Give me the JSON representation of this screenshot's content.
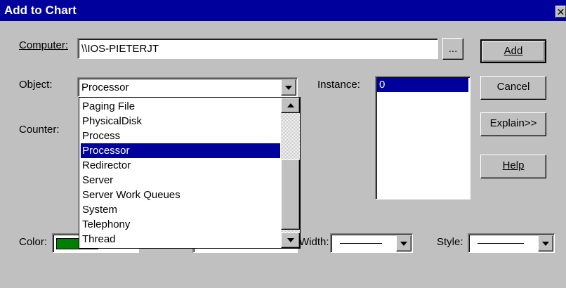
{
  "window": {
    "title": "Add to Chart",
    "close_label": "✕"
  },
  "computer": {
    "label": "Computer:",
    "value": "\\\\IOS-PIETERJT",
    "browse_label": "..."
  },
  "object": {
    "label": "Object:",
    "value": "Processor"
  },
  "instance": {
    "label": "Instance:",
    "items": [
      "0"
    ]
  },
  "counter": {
    "label": "Counter:"
  },
  "object_dropdown": {
    "items": [
      "Paging File",
      "PhysicalDisk",
      "Process",
      "Processor",
      "Redirector",
      "Server",
      "Server Work Queues",
      "System",
      "Telephony",
      "Thread"
    ],
    "selected_index": 3
  },
  "buttons": {
    "add": "Add",
    "cancel": "Cancel",
    "explain": "Explain>>",
    "help": "Help"
  },
  "color": {
    "label": "Color:",
    "swatch": "#008000"
  },
  "width": {
    "label": "Width:"
  },
  "style": {
    "label": "Style:"
  },
  "colors": {
    "titlebar": "#00009c",
    "face": "#c0c0c0",
    "selection": "#00009c"
  }
}
